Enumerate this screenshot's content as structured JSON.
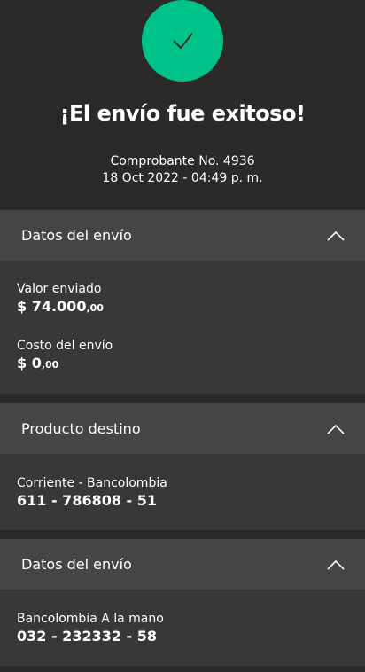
{
  "receipt": {
    "title": "¡El envío fue exitoso!",
    "voucher": "Comprobante No. 4936",
    "datetime": "18 Oct 2022 - 04:49 p. m.",
    "status_color": "#00c389"
  },
  "sections": [
    {
      "header": "Datos del envío",
      "fields": [
        {
          "label": "Valor enviado",
          "value": "$ 74.000",
          "cents": ",00"
        },
        {
          "label": "Costo del envío",
          "value": "$ 0",
          "cents": ",00"
        }
      ]
    },
    {
      "header": "Producto destino",
      "fields": [
        {
          "label": "Corriente - Bancolombia",
          "value": "611 - 786808 - 51"
        }
      ]
    },
    {
      "header": "Datos del envío",
      "fields": [
        {
          "label": "Bancolombia A la mano",
          "value": "032 - 232332 - 58"
        }
      ]
    }
  ],
  "icons": {
    "status": "checkmark-icon",
    "collapse": "chevron-up-icon"
  }
}
